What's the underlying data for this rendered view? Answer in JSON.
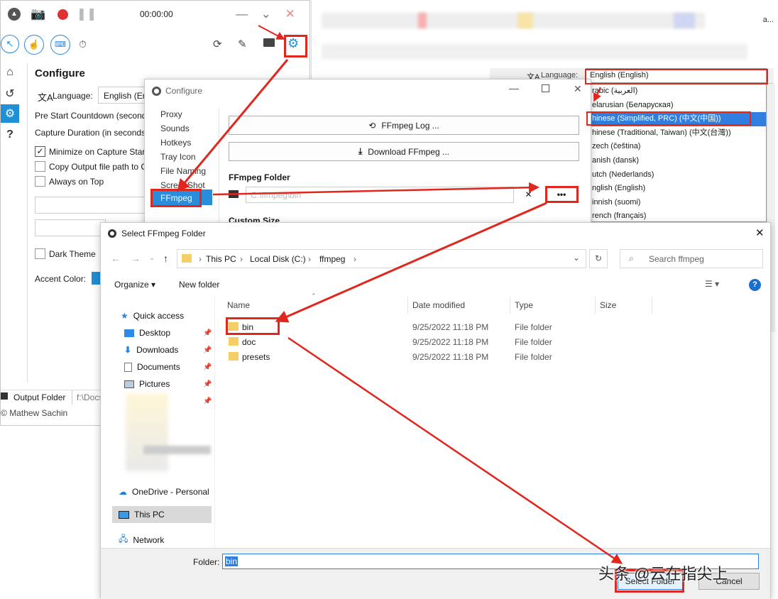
{
  "recorder": {
    "timer": "00:00:00",
    "configure_title": "Configure",
    "language_label": "Language:",
    "language_value": "English (En",
    "pre_start": "Pre Start Countdown (second",
    "capture_duration": "Capture Duration (in seconds",
    "minimize_label": "Minimize on Capture Star",
    "copy_label": "Copy Output file path to C",
    "always_top_label": "Always on Top",
    "dark_theme_label": "Dark Theme",
    "accent_label": "Accent Color:",
    "output_folder_label": "Output Folder",
    "output_path": "f:\\Docs",
    "author": "Mathew Sachin"
  },
  "background": {
    "language_label": "Language:",
    "language_value": "English (English)",
    "languages": [
      "Arabic (العربية)",
      "Belarusian (Беларуская)",
      "Chinese (Simplified, PRC) (中文(中国))",
      "Chinese (Traditional, Taiwan) (中文(台灣))",
      "Czech (čeština)",
      "Danish (dansk)",
      "Dutch (Nederlands)",
      "English (English)",
      "Finnish (suomi)",
      "French (français)"
    ],
    "languages_shown": [
      "rabic (العربية)",
      "elarusian (Беларуская)",
      "hinese (Simplified, PRC) (中文(中国))",
      "hinese (Traditional, Taiwan) (中文(台灣))",
      "zech (čeština)",
      "anish (dansk)",
      "utch (Nederlands)",
      "nglish (English)",
      "innish (suomi)",
      "rench (français)"
    ],
    "selected_index": 2,
    "top_text": "a..."
  },
  "configure": {
    "title": "Configure",
    "nav": [
      "Proxy",
      "Sounds",
      "Hotkeys",
      "Tray Icon",
      "File Naming",
      "ScreenShot",
      "FFmpeg"
    ],
    "ffmpeg_log_btn": "FFmpeg Log ...",
    "download_btn": "Download FFmpeg ...",
    "folder_heading": "FFmpeg Folder",
    "folder_path": "C:\\ffmpeg\\bin",
    "clear_symbol": "✕",
    "browse_symbol": "•••",
    "custom_size": "Custom Size"
  },
  "dialog": {
    "title": "Select FFmpeg Folder",
    "breadcrumb": [
      "This PC",
      "Local Disk (C:)",
      "ffmpeg"
    ],
    "search_placeholder": "Search ffmpeg",
    "organize": "Organize ▾",
    "new_folder": "New folder",
    "help": "?",
    "columns": [
      "Name",
      "Date modified",
      "Type",
      "Size"
    ],
    "files": [
      {
        "name": "bin",
        "date": "9/25/2022 11:18 PM",
        "type": "File folder"
      },
      {
        "name": "doc",
        "date": "9/25/2022 11:18 PM",
        "type": "File folder"
      },
      {
        "name": "presets",
        "date": "9/25/2022 11:18 PM",
        "type": "File folder"
      }
    ],
    "nav": {
      "quick_access": "Quick access",
      "desktop": "Desktop",
      "downloads": "Downloads",
      "documents": "Documents",
      "pictures": "Pictures",
      "onedrive": "OneDrive - Personal",
      "this_pc": "This PC",
      "network": "Network"
    },
    "folder_label": "Folder:",
    "folder_value": "bin",
    "select_btn": "Select Folder",
    "cancel_btn": "Cancel"
  },
  "watermark": "头条 @云在指尖上",
  "colors": {
    "accent_red": "#e0261d",
    "selection_blue": "#2f7fe0",
    "gear_blue": "#1f8fd6"
  }
}
